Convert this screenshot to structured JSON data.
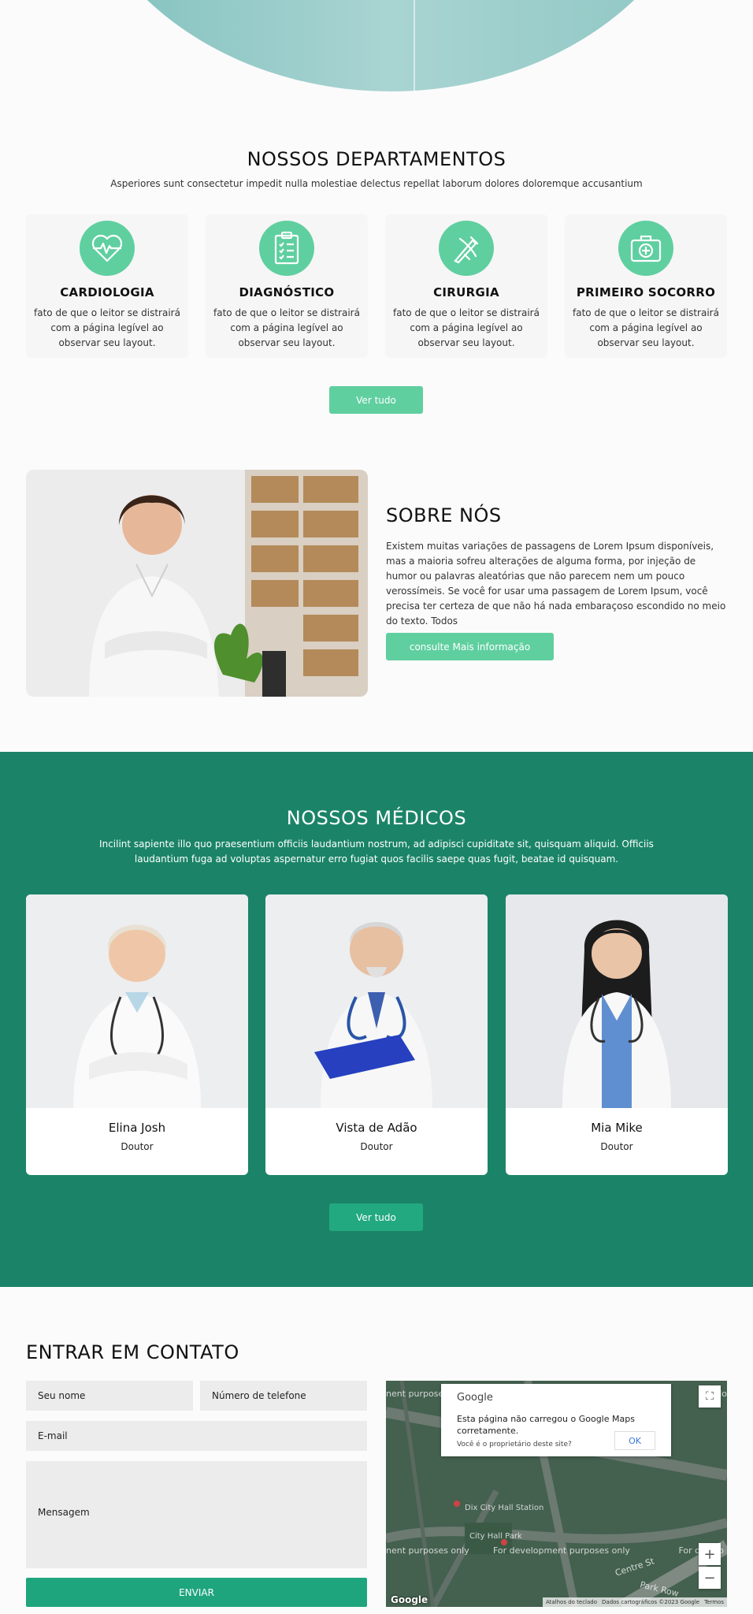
{
  "departments": {
    "title": "NOSSOS DEPARTAMENTOS",
    "subtitle": "Asperiores sunt consectetur impedit nulla molestiae delectus repellat laborum dolores doloremque accusantium",
    "items": [
      {
        "name": "CARDIOLOGIA",
        "icon": "heartbeat-icon",
        "desc": "fato de que o leitor se distrairá com a página legível ao observar seu layout."
      },
      {
        "name": "DIAGNÓSTICO",
        "icon": "clipboard-icon",
        "desc": "fato de que o leitor se distrairá com a página legível ao observar seu layout."
      },
      {
        "name": "CIRURGIA",
        "icon": "surgery-icon",
        "desc": "fato de que o leitor se distrairá com a página legível ao observar seu layout."
      },
      {
        "name": "PRIMEIRO SOCORRO",
        "icon": "first-aid-icon",
        "desc": "fato de que o leitor se distrairá com a página legível ao observar seu layout."
      }
    ],
    "button": "Ver tudo"
  },
  "about": {
    "title": "SOBRE NÓS",
    "text": "Existem muitas variações de passagens de Lorem Ipsum disponíveis, mas a maioria sofreu alterações de alguma forma, por injeção de humor ou palavras aleatórias que não parecem nem um pouco verossímeis. Se você for usar uma passagem de Lorem Ipsum, você precisa ter certeza de que não há nada embaraçoso escondido no meio do texto. Todos",
    "button": "consulte Mais informação"
  },
  "doctors": {
    "title": "NOSSOS MÉDICOS",
    "subtitle": "Incilint sapiente illo quo praesentium officiis laudantium nostrum, ad adipisci cupiditate sit, quisquam aliquid. Officiis laudantium fuga ad voluptas aspernatur erro fugiat quos facilis saepe quas fugit, beatae id quisquam.",
    "items": [
      {
        "name": "Elina Josh",
        "role": "Doutor"
      },
      {
        "name": "Vista de Adão",
        "role": "Doutor"
      },
      {
        "name": "Mia Mike",
        "role": "Doutor"
      }
    ],
    "button": "Ver tudo"
  },
  "contact": {
    "title": "ENTRAR EM CONTATO",
    "name_placeholder": "Seu nome",
    "phone_placeholder": "Número de telefone",
    "email_placeholder": "E-mail",
    "message_placeholder": "Mensagem",
    "send": "ENVIAR"
  },
  "map": {
    "google": "Google",
    "error": "Esta página não carregou o Google Maps corretamente.",
    "owner": "Você é o proprietário deste site?",
    "ok": "OK",
    "dev_watermark": "For development purposes only",
    "place1": "Dix City Hall Station",
    "place2": "City Hall Park",
    "street": "Centre St",
    "street2": "Park Row",
    "footer": [
      "Atalhos do teclado",
      "Dados cartográficos ©2023 Google",
      "Termos"
    ]
  },
  "colors": {
    "accent": "#5fcf9f",
    "dark_green": "#1b8468",
    "send": "#1fa57e"
  }
}
